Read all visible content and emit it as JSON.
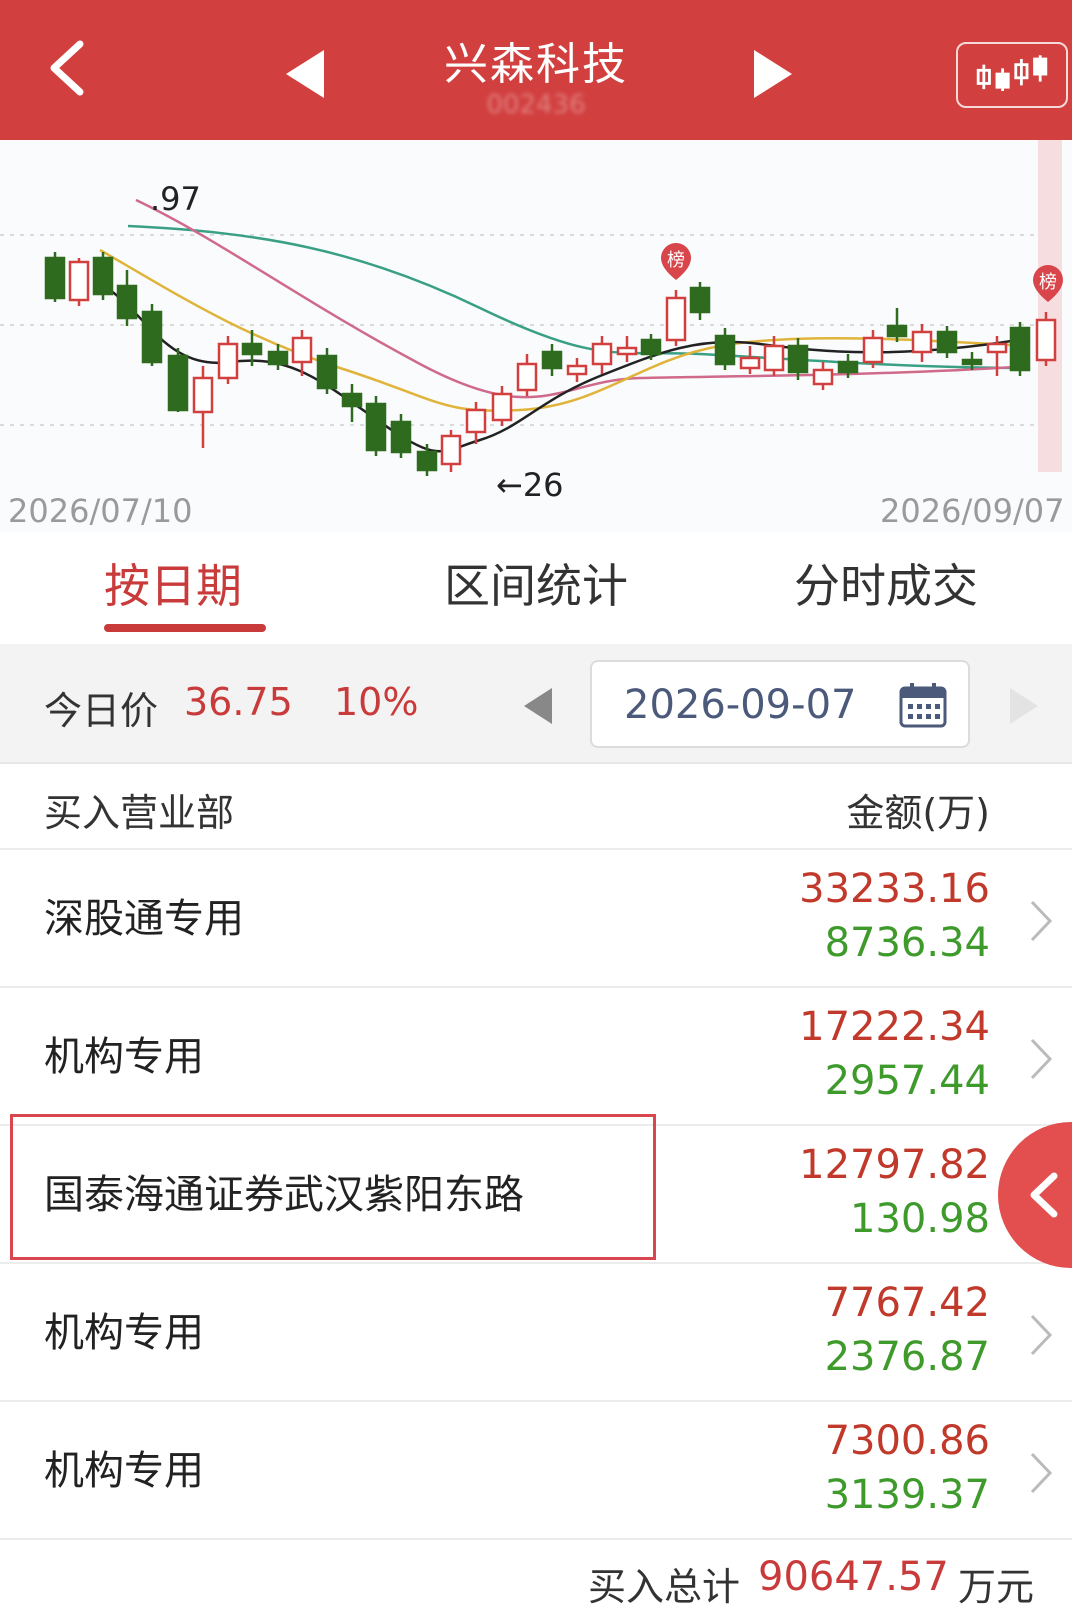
{
  "header": {
    "title": "兴森科技",
    "code": "002436"
  },
  "kline": {
    "start_date": "2026/07/10",
    "end_date": "2026/09/07",
    "high_label": ".97",
    "low_label": "←26",
    "badge_label": "榜",
    "colors": {
      "up": "#d23f3f",
      "down": "#2e6b1f",
      "ma5": "#222222",
      "ma10": "#e0b43a",
      "ma20": "#d06a8a",
      "ma30": "#3aa085"
    }
  },
  "tabs": [
    {
      "label": "按日期",
      "active": true
    },
    {
      "label": "区间统计",
      "active": false
    },
    {
      "label": "分时成交",
      "active": false
    }
  ],
  "price": {
    "label": "今日价",
    "value": "36.75",
    "change": "10%",
    "date": "2026-09-07"
  },
  "list": {
    "col_broker": "买入营业部",
    "col_amount": "金额(万)",
    "rows": [
      {
        "name": "深股通专用",
        "buy": "33233.16",
        "sell": "8736.34"
      },
      {
        "name": "机构专用",
        "buy": "17222.34",
        "sell": "2957.44"
      },
      {
        "name": "国泰海通证券武汉紫阳东路",
        "buy": "12797.82",
        "sell": "130.98"
      },
      {
        "name": "机构专用",
        "buy": "7767.42",
        "sell": "2376.87"
      },
      {
        "name": "机构专用",
        "buy": "7300.86",
        "sell": "3139.37"
      }
    ]
  },
  "total": {
    "label": "买入总计",
    "value": "90647.57",
    "unit": "万元"
  }
}
